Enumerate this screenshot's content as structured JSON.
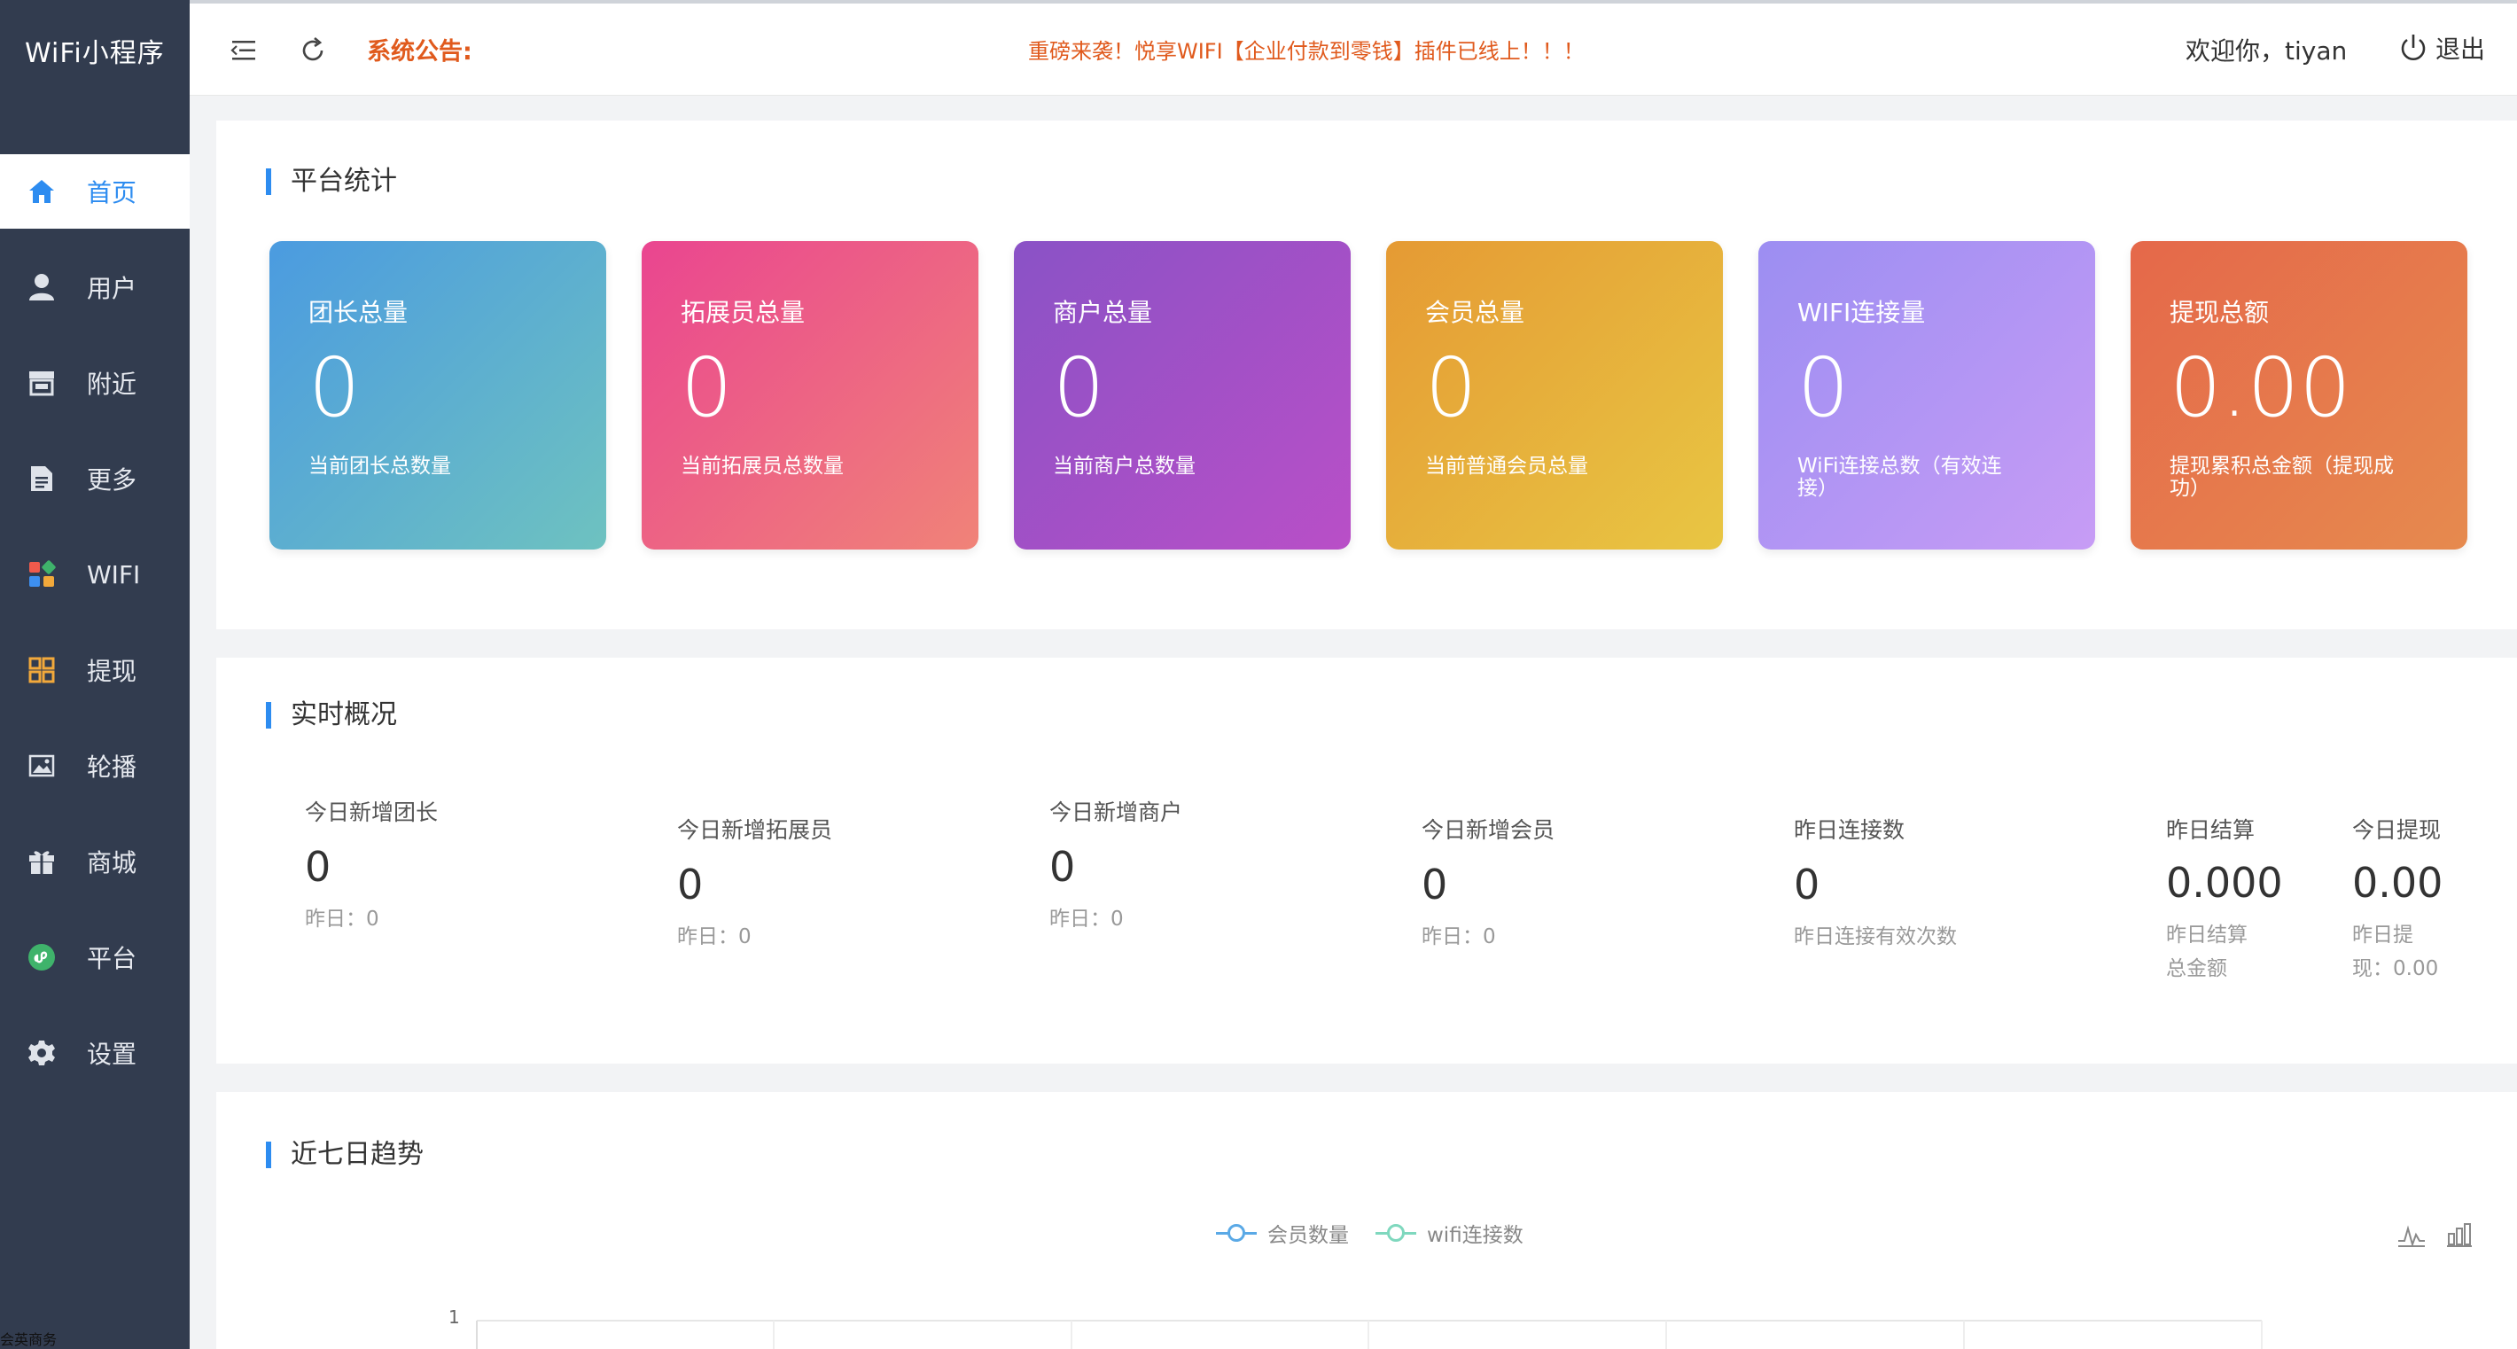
{
  "app": {
    "title": "WiFi小程序",
    "footer_text": "会英商务"
  },
  "sidebar": {
    "items": [
      {
        "label": "首页",
        "icon": "home-icon",
        "active": true
      },
      {
        "label": "用户",
        "icon": "user-icon",
        "active": false
      },
      {
        "label": "附近",
        "icon": "store-icon",
        "active": false
      },
      {
        "label": "更多",
        "icon": "document-icon",
        "active": false
      },
      {
        "label": "WIFI",
        "icon": "apps-icon",
        "active": false
      },
      {
        "label": "提现",
        "icon": "grid-icon",
        "active": false
      },
      {
        "label": "轮播",
        "icon": "image-icon",
        "active": false
      },
      {
        "label": "商城",
        "icon": "gift-icon",
        "active": false
      },
      {
        "label": "平台",
        "icon": "mini-program-icon",
        "active": false
      },
      {
        "label": "设置",
        "icon": "gear-icon",
        "active": false
      }
    ]
  },
  "topbar": {
    "notice_label": "系统公告:",
    "notice_text": "重磅来袭！悦享WIFI【企业付款到零钱】插件已线上！！！",
    "welcome": "欢迎你，tiyan",
    "logout_label": "退出"
  },
  "platform_stats": {
    "title": "平台统计",
    "cards": [
      {
        "title": "团长总量",
        "value": "0",
        "desc": "当前团长总数量",
        "from": "#4b9be0",
        "to": "#6ec2c0"
      },
      {
        "title": "拓展员总量",
        "value": "0",
        "desc": "当前拓展员总数量",
        "from": "#ea4590",
        "to": "#f08378"
      },
      {
        "title": "商户总量",
        "value": "0",
        "desc": "当前商户总数量",
        "from": "#8a52c6",
        "to": "#b94fc7"
      },
      {
        "title": "会员总量",
        "value": "0",
        "desc": "当前普通会员总量",
        "from": "#e59a34",
        "to": "#e8c643"
      },
      {
        "title": "WIFI连接量",
        "value": "0",
        "desc": "WiFi连接总数（有效连接）",
        "from": "#9c8ef2",
        "to": "#c79cf5"
      },
      {
        "title": "提现总额",
        "value": "0.00",
        "desc": "提现累积总金额（提现成功）",
        "from": "#e5684a",
        "to": "#e68a4e"
      }
    ]
  },
  "realtime": {
    "title": "实时概况",
    "items": [
      {
        "title": "今日新增团长",
        "value": "0",
        "sub": "昨日：0"
      },
      {
        "title": "今日新增拓展员",
        "value": "0",
        "sub": "昨日：0"
      },
      {
        "title": "今日新增商户",
        "value": "0",
        "sub": "昨日：0"
      },
      {
        "title": "今日新增会员",
        "value": "0",
        "sub": "昨日：0"
      },
      {
        "title": "昨日连接数",
        "value": "0",
        "sub": "昨日连接有效次数"
      },
      {
        "title": "昨日结算",
        "value": "0.000",
        "sub": "昨日结算总金额"
      },
      {
        "title": "今日提现",
        "value": "0.00",
        "sub": "昨日提现：0.00"
      }
    ]
  },
  "trend": {
    "title": "近七日趋势",
    "legend": [
      {
        "name": "会员数量",
        "color": "#5aa9e6"
      },
      {
        "name": "wifi连接数",
        "color": "#7fd8be"
      }
    ],
    "y_max_label": "1"
  },
  "chart_data": {
    "type": "line",
    "title": "",
    "series": [
      {
        "name": "会员数量",
        "values": []
      },
      {
        "name": "wifi连接数",
        "values": []
      }
    ],
    "ylim": [
      0,
      1
    ],
    "legend_position": "top-center"
  }
}
